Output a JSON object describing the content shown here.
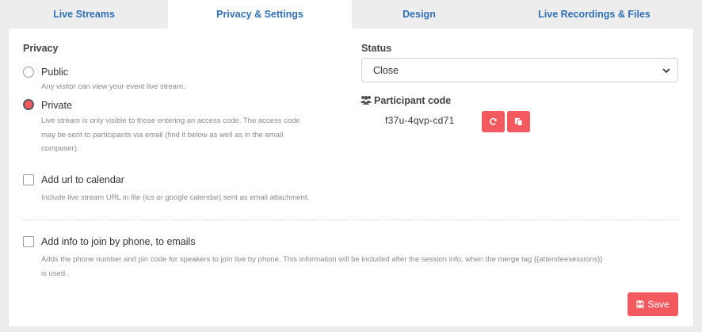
{
  "tabs": [
    {
      "label": "Live Streams"
    },
    {
      "label": "Privacy & Settings"
    },
    {
      "label": "Design"
    },
    {
      "label": "Live Recordings & Files"
    }
  ],
  "active_tab": "Privacy & Settings",
  "privacy": {
    "title": "Privacy",
    "public": {
      "label": "Public",
      "help": "Any visitor can view your event live stream.",
      "selected": false
    },
    "private": {
      "label": "Private",
      "help_lines": [
        "Live stream is only visible to those entering an access code. The access code",
        "may be sent to participants via email (find it below as well as in the email",
        "composer)."
      ],
      "selected": true
    }
  },
  "calendar": {
    "label": "Add url to calendar",
    "help": "Include live stream URL in file (ics or google calendar) sent as email attachment.",
    "checked": false
  },
  "phone": {
    "label": "Add info to join by phone, to emails",
    "help_lines": [
      "Adds the phone number and pin code for speakers to join live by phone. This information will be included after the session info, when the merge tag {{attendeesessions}}",
      "is used."
    ],
    "checked": false
  },
  "status": {
    "title": "Status",
    "value": "Close"
  },
  "participant": {
    "title": "Participant code",
    "code": "f37u-4qvp-cd71",
    "icons": [
      "users-icon",
      "refresh-icon",
      "copy-icon"
    ]
  },
  "save_label": "Save",
  "colors": {
    "accent": "#f25a5f",
    "tab_text": "#2f6fb5"
  }
}
